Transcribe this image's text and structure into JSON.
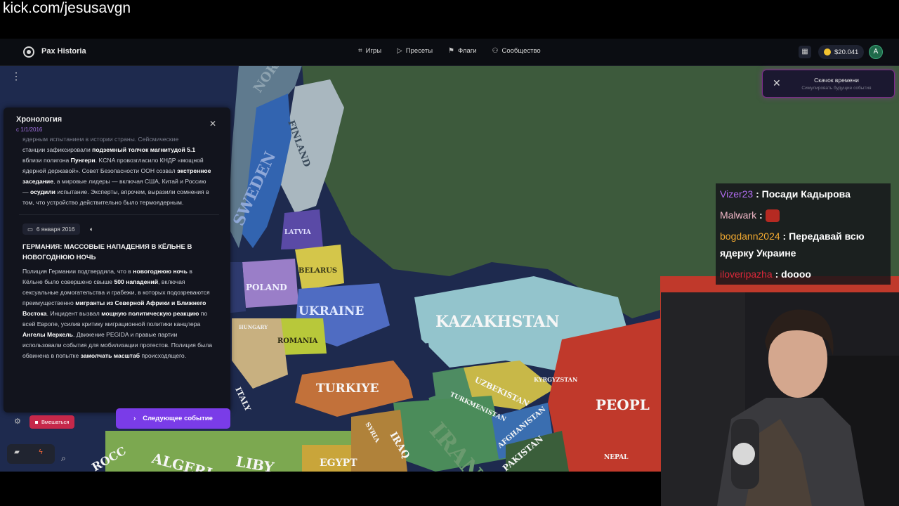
{
  "stream": {
    "url": "kick.com/jesusavgn"
  },
  "app": {
    "brand": "Pax Historia",
    "nav": [
      {
        "icon": "gamepad-icon",
        "glyph": "⌗",
        "label": "Игры"
      },
      {
        "icon": "play-icon",
        "glyph": "▷",
        "label": "Пресеты"
      },
      {
        "icon": "flag-icon",
        "glyph": "⚑",
        "label": "Флаги"
      },
      {
        "icon": "users-icon",
        "glyph": "⚇",
        "label": "Сообщество"
      }
    ],
    "balance": "$20.041",
    "avatar_letter": "A"
  },
  "timeskip": {
    "title": "Скачок времени",
    "subtitle": "Симулировать будущие события"
  },
  "timeline": {
    "title": "Хронология",
    "date": "с 1/1/2016",
    "prev_event": {
      "faded_line": "ядерным испытанием в истории страны. Сейсмические",
      "line1_pre": "станции зафиксировали ",
      "line1_bold": "подземный толчок магнитудой",
      "line2_bold_a": "5.1",
      "line2_mid": " вблизи полигона ",
      "line2_bold_b": "Пунгери",
      "line2_post": ". KCNA провозгласило КНДР «мощной ядерной державой». Совет Безопасности ООН созвал ",
      "bold_c": "экстренное заседание",
      "mid_c": ", а мировые лидеры — включая США, Китай и Россию — ",
      "bold_d": "осудили",
      "end": " испытание. Эксперты, впрочем, выразили сомнения в том, что устройство действительно было термоядерным."
    },
    "event": {
      "date": "6 января 2016",
      "title": "ГЕРМАНИЯ: МАССОВЫЕ НАПАДЕНИЯ В КЁЛЬНЕ В НОВОГОДНЮЮ НОЧЬ",
      "t1": "Полиция Германии подтвердила, что в ",
      "b1": "новогоднюю ночь",
      "t2": " в Кёльне было совершено свыше ",
      "b2": "500 нападений",
      "t3": ", включая сексуальные домогательства и грабежи, в которых подозреваются преимущественно ",
      "b3": "мигранты из Северной Африки и Ближнего Востока",
      "t4": ". Инцидент вызвал ",
      "b4": "мощную политическую реакцию",
      "t5": " по всей Европе, усилив критику миграционной политики канцлера ",
      "b5": "Ангелы Меркель",
      "t6": ". Движение PEGIDA и правые партии использовали события для мобилизации протестов. Полиция была обвинена в попытке ",
      "b6": "замолчать масштаб",
      "t7": " происходящего."
    },
    "intervene_label": "Вмешаться",
    "next_label": "Следующее событие"
  },
  "map_labels": {
    "finland": "FINLAND",
    "sweden": "SWEDEN",
    "norway": "NORWAY",
    "latvia": "LATVIA",
    "belarus": "BELARUS",
    "poland": "POLAND",
    "ukraine": "UKRAINE",
    "romania": "ROMANIA",
    "hungary": "HUNGARY",
    "italy": "ITALY",
    "kazakhstan": "KAZAKHSTAN",
    "uzbekistan": "UZBEKISTAN",
    "turkmenistan": "TURKMENISTAN",
    "kyrgyzstan": "KYRGYZSTAN",
    "turkiye": "TURKIYE",
    "syria": "SYRIA",
    "iraq": "IRAQ",
    "iran": "IRAN",
    "afghanistan": "AFGHANISTAN",
    "pakistan": "PAKISTAN",
    "nepal": "NEPAL",
    "people": "PEOPL",
    "algeria": "ALGERI",
    "morocco": "ROCC",
    "libya": "LIBY",
    "egypt": "EGYPT"
  },
  "chat": [
    {
      "user": "Vizer23",
      "color": "#b06cf0",
      "text": ": Посади Кадырова"
    },
    {
      "user": "Malwark",
      "color": "#f2b8c8",
      "text": ":",
      "emote": true
    },
    {
      "user": "bogdann2024",
      "color": "#f0a830",
      "text": ": Передавай всю ядерку Украине"
    },
    {
      "user": "iloveripazha",
      "color": "#e0283a",
      "text": ": doooo"
    }
  ]
}
